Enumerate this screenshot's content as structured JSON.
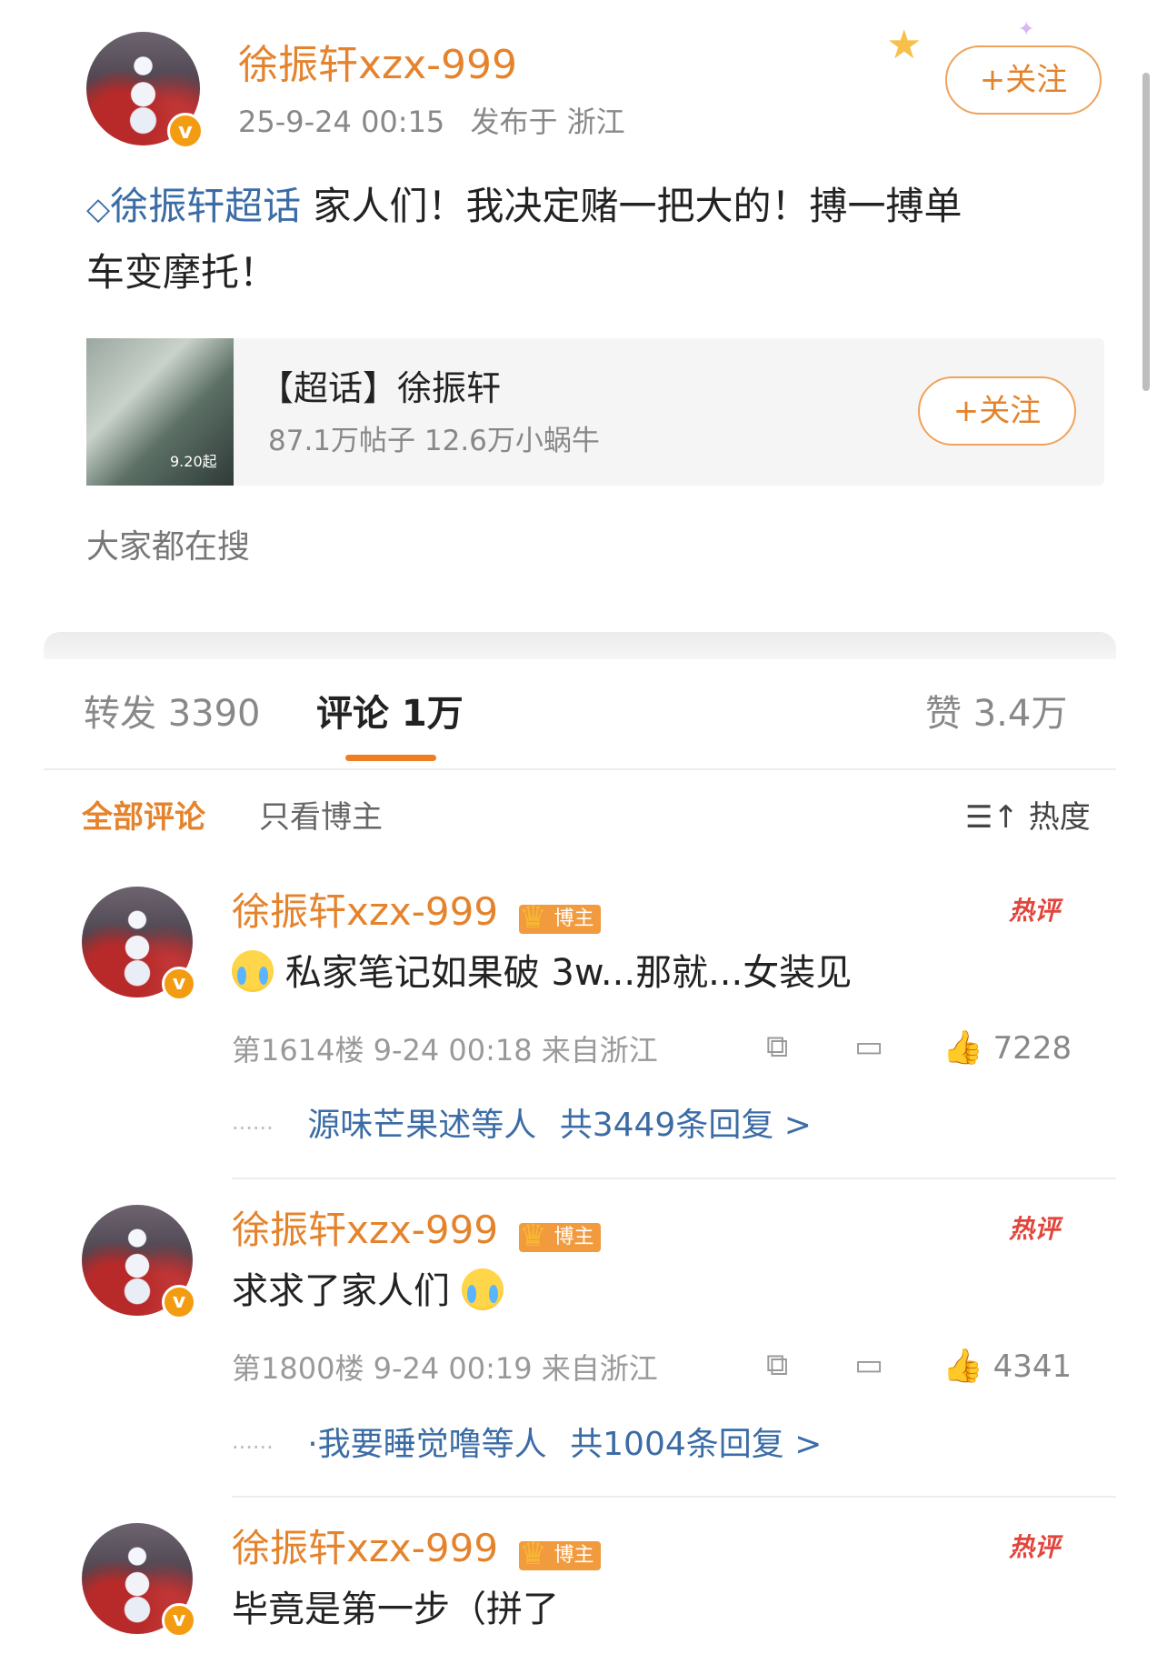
{
  "post": {
    "author": "徐振轩xzx-999",
    "timestamp": "25-9-24 00:15",
    "location": "发布于 浙江",
    "follow_label": "+关注",
    "topic_link": "徐振轩超话",
    "text_line1": "家人们！我决定赌一把大的！搏一搏单",
    "text_line2": "车变摩托！"
  },
  "topic_card": {
    "title": "【超话】徐振轩",
    "stats": "87.1万帖子  12.6万小蜗牛",
    "follow_label": "+关注",
    "thumb_text": "9.20起"
  },
  "everyone_searching": "大家都在搜",
  "tabs": {
    "repost": "转发 3390",
    "comments": "评论 1万",
    "likes": "赞 3.4万"
  },
  "filters": {
    "all": "全部评论",
    "host_only": "只看博主",
    "sort": "热度"
  },
  "comments": [
    {
      "author": "徐振轩xzx-999",
      "tag": "博主",
      "hot": "热评",
      "text": "私家笔记如果破 3w...那就...女装见",
      "floor": "第1614楼  9-24 00:18  来自浙江",
      "likes": "7228",
      "replies_names": "源味芒果述等人",
      "replies_count": "共3449条回复 >"
    },
    {
      "author": "徐振轩xzx-999",
      "tag": "博主",
      "hot": "热评",
      "text": "求求了家人们",
      "floor": "第1800楼  9-24 00:19  来自浙江",
      "likes": "4341",
      "replies_names": "·我要睡觉噜等人",
      "replies_count": "共1004条回复 >"
    },
    {
      "author": "徐振轩xzx-999",
      "tag": "博主",
      "hot": "热评",
      "text": "毕竟是第一步（拼了"
    }
  ],
  "colors": {
    "accent": "#e5832d",
    "link": "#3b6ca5",
    "hot": "#e2453c",
    "badge": "#f39c12"
  }
}
